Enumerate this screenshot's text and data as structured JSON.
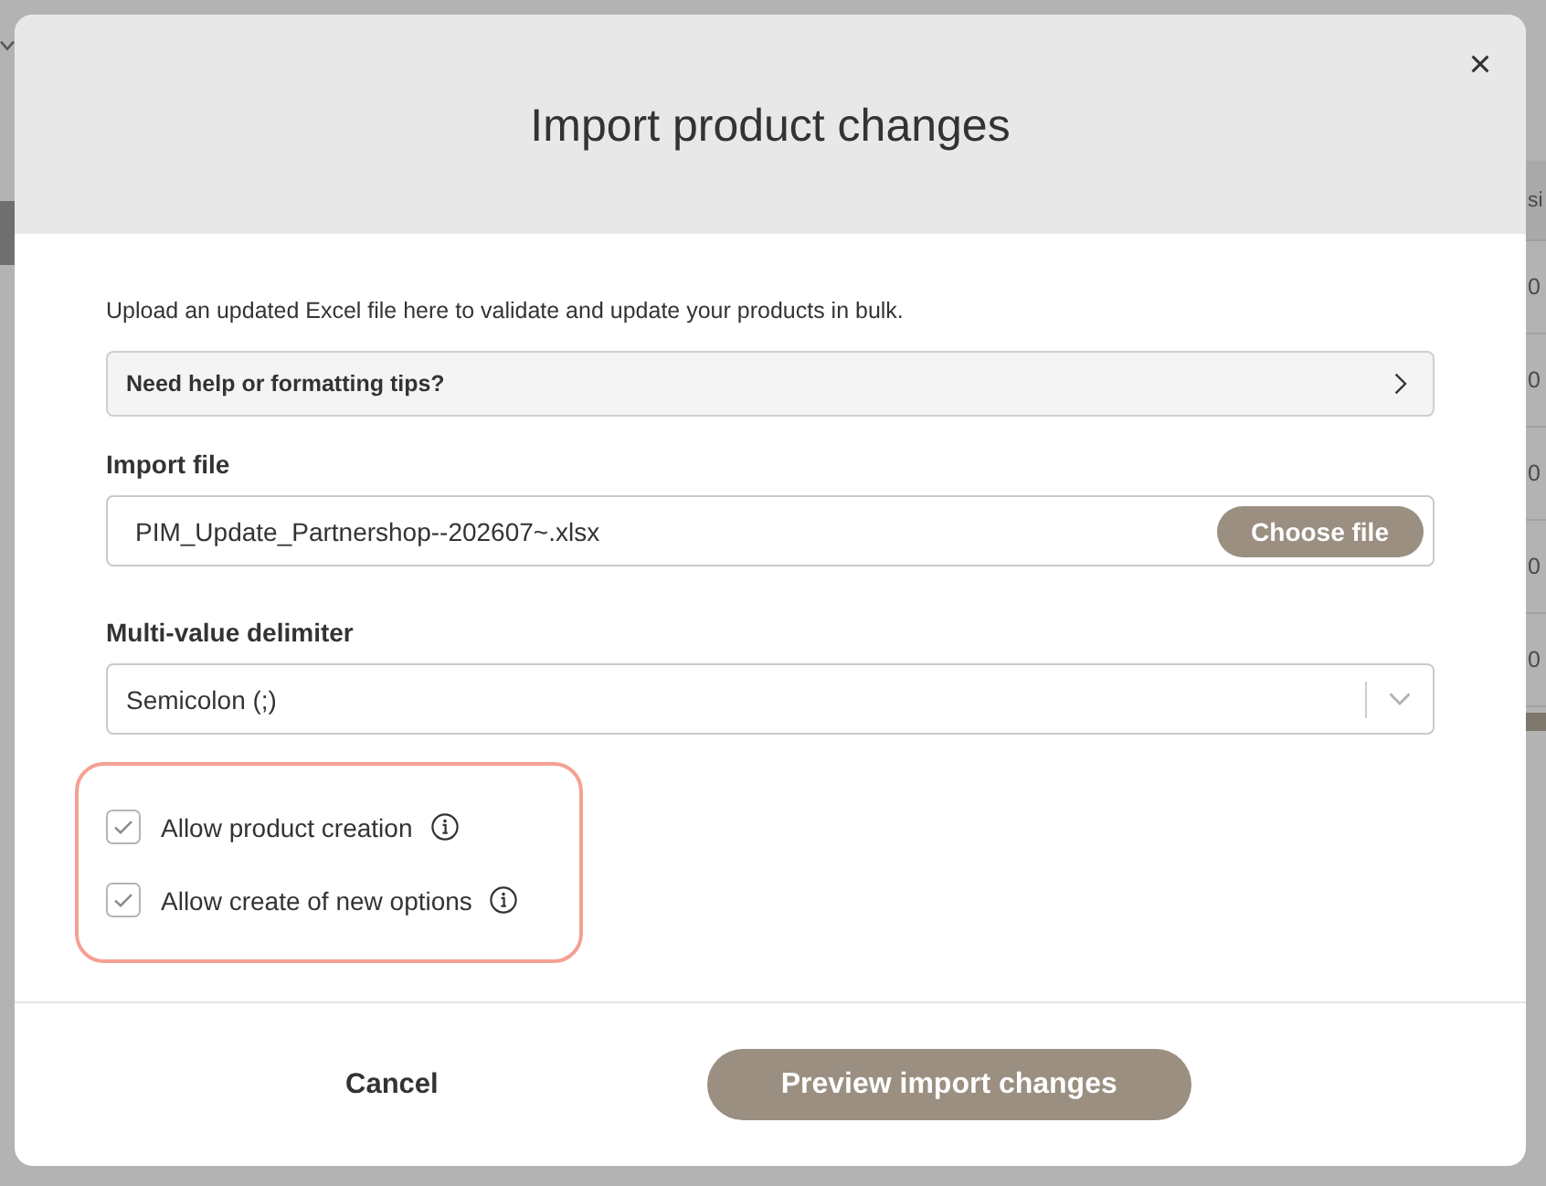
{
  "background_page": {
    "table_header": "si",
    "table_cells": [
      "0",
      "0",
      "0",
      "0",
      "0"
    ]
  },
  "dialog": {
    "title": "Import product changes",
    "intro": "Upload an updated Excel file here to validate and update your products in bulk.",
    "help_link": "Need help or formatting tips?",
    "import_file": {
      "label": "Import file",
      "value": "PIM_Update_Partnershop--202607~.xlsx",
      "button": "Choose file"
    },
    "delimiter": {
      "label": "Multi-value delimiter",
      "value": "Semicolon (;)"
    },
    "options": [
      {
        "label": "Allow product creation",
        "checked": true
      },
      {
        "label": "Allow create of new options",
        "checked": true
      }
    ],
    "buttons": [
      {
        "label": "Cancel",
        "kind": "secondary"
      },
      {
        "label": "Preview import changes",
        "kind": "primary"
      }
    ]
  }
}
